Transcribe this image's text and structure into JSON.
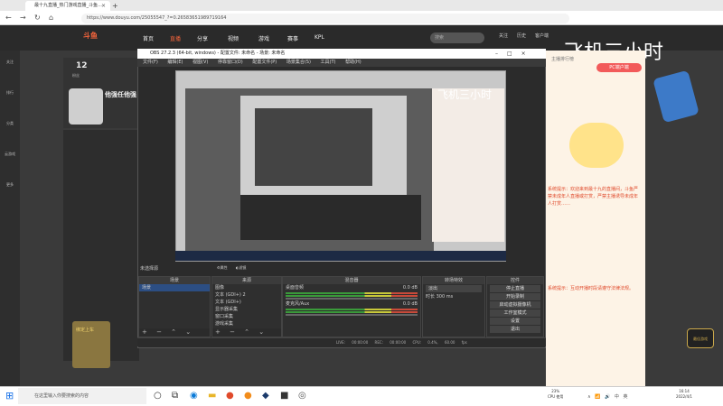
{
  "browser": {
    "tab_title": "最十九直播_热门游戏直播_斗鱼…",
    "url": "https://www.douyu.com/25055547_?=0.26583651989719164",
    "new_tab": "+",
    "close": "×"
  },
  "douyu": {
    "logo": "斗鱼",
    "nav": [
      "首页",
      "直播",
      "分享",
      "视频",
      "游戏",
      "赛事",
      "KPL"
    ],
    "search_placeholder": "搜索",
    "header_icons": [
      "关注",
      "历史",
      "客户端",
      "开播"
    ],
    "room_number": "12",
    "room_sub": "粉丝",
    "anchor_name": "他强任他强",
    "big_title": "飞机三小时",
    "pk_button": "PC端户端",
    "rank_tab": "主播排行榜",
    "chat_lines": [
      "系统提示：欢迎来到最十九的直播间，斗鱼严禁未成年人直播或打赏，严禁主播诱导未成年人打赏……"
    ],
    "chat_line2": "系统提示：互动开播时段请遵守法律法规。",
    "promo_text": "绑定上车",
    "game_badge": "最佳游戏"
  },
  "rail": [
    "关注",
    "排行",
    "分类",
    "云游戏",
    "更多"
  ],
  "obs": {
    "title": "OBS 27.2.3 (64-bit, windows) - 配置文件: 未命名 - 场景: 未命名",
    "menu": [
      "文件(F)",
      "编辑(E)",
      "视图(V)",
      "停靠窗口(D)",
      "配置文件(P)",
      "场景集合(S)",
      "工具(T)",
      "帮助(H)"
    ],
    "preview_title": "飞机三小时",
    "no_source": "未选择源",
    "prop_tabs": [
      "属性",
      "滤镜"
    ],
    "docks": {
      "scenes": "场景",
      "sources": "来源",
      "mixer": "混音器",
      "transitions": "转场特效",
      "controls": "控件"
    },
    "scene_items": [
      "场景"
    ],
    "source_items": [
      "图像",
      "文本 (GDI+) 2",
      "文本 (GDI+)",
      "显示器采集",
      "窗口采集",
      "游戏采集"
    ],
    "mixer_channels": [
      {
        "name": "桌面音频",
        "db": "0.0 dB"
      },
      {
        "name": "麦克风/Aux",
        "db": "0.0 dB"
      }
    ],
    "transition": "淡出",
    "duration_label": "时长",
    "duration_value": "300 ms",
    "control_buttons": [
      "停止直播",
      "开始录制",
      "启动虚拟摄像机",
      "工作室模式",
      "设置",
      "退出"
    ],
    "status": [
      "LIVE: 00:00:00",
      "REC: 00:00:00",
      "CPU: 0.4%, 60.00 fps"
    ],
    "dock_footer": "+ − ⌃ ⌄"
  },
  "taskbar": {
    "search_placeholder": "在这里输入你要搜索的内容",
    "cpu": "23%",
    "cpu_label": "CPU 使用",
    "tray": "∧ 📶 🔊 中",
    "lang": "英",
    "time": "16:14",
    "date": "2022/4/1"
  }
}
